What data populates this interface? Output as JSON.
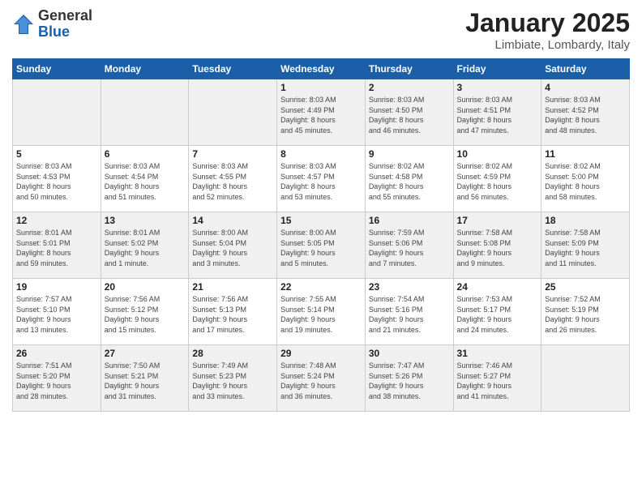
{
  "logo": {
    "general": "General",
    "blue": "Blue"
  },
  "title": "January 2025",
  "location": "Limbiate, Lombardy, Italy",
  "weekdays": [
    "Sunday",
    "Monday",
    "Tuesday",
    "Wednesday",
    "Thursday",
    "Friday",
    "Saturday"
  ],
  "weeks": [
    [
      {
        "day": "",
        "info": ""
      },
      {
        "day": "",
        "info": ""
      },
      {
        "day": "",
        "info": ""
      },
      {
        "day": "1",
        "info": "Sunrise: 8:03 AM\nSunset: 4:49 PM\nDaylight: 8 hours\nand 45 minutes."
      },
      {
        "day": "2",
        "info": "Sunrise: 8:03 AM\nSunset: 4:50 PM\nDaylight: 8 hours\nand 46 minutes."
      },
      {
        "day": "3",
        "info": "Sunrise: 8:03 AM\nSunset: 4:51 PM\nDaylight: 8 hours\nand 47 minutes."
      },
      {
        "day": "4",
        "info": "Sunrise: 8:03 AM\nSunset: 4:52 PM\nDaylight: 8 hours\nand 48 minutes."
      }
    ],
    [
      {
        "day": "5",
        "info": "Sunrise: 8:03 AM\nSunset: 4:53 PM\nDaylight: 8 hours\nand 50 minutes."
      },
      {
        "day": "6",
        "info": "Sunrise: 8:03 AM\nSunset: 4:54 PM\nDaylight: 8 hours\nand 51 minutes."
      },
      {
        "day": "7",
        "info": "Sunrise: 8:03 AM\nSunset: 4:55 PM\nDaylight: 8 hours\nand 52 minutes."
      },
      {
        "day": "8",
        "info": "Sunrise: 8:03 AM\nSunset: 4:57 PM\nDaylight: 8 hours\nand 53 minutes."
      },
      {
        "day": "9",
        "info": "Sunrise: 8:02 AM\nSunset: 4:58 PM\nDaylight: 8 hours\nand 55 minutes."
      },
      {
        "day": "10",
        "info": "Sunrise: 8:02 AM\nSunset: 4:59 PM\nDaylight: 8 hours\nand 56 minutes."
      },
      {
        "day": "11",
        "info": "Sunrise: 8:02 AM\nSunset: 5:00 PM\nDaylight: 8 hours\nand 58 minutes."
      }
    ],
    [
      {
        "day": "12",
        "info": "Sunrise: 8:01 AM\nSunset: 5:01 PM\nDaylight: 8 hours\nand 59 minutes."
      },
      {
        "day": "13",
        "info": "Sunrise: 8:01 AM\nSunset: 5:02 PM\nDaylight: 9 hours\nand 1 minute."
      },
      {
        "day": "14",
        "info": "Sunrise: 8:00 AM\nSunset: 5:04 PM\nDaylight: 9 hours\nand 3 minutes."
      },
      {
        "day": "15",
        "info": "Sunrise: 8:00 AM\nSunset: 5:05 PM\nDaylight: 9 hours\nand 5 minutes."
      },
      {
        "day": "16",
        "info": "Sunrise: 7:59 AM\nSunset: 5:06 PM\nDaylight: 9 hours\nand 7 minutes."
      },
      {
        "day": "17",
        "info": "Sunrise: 7:58 AM\nSunset: 5:08 PM\nDaylight: 9 hours\nand 9 minutes."
      },
      {
        "day": "18",
        "info": "Sunrise: 7:58 AM\nSunset: 5:09 PM\nDaylight: 9 hours\nand 11 minutes."
      }
    ],
    [
      {
        "day": "19",
        "info": "Sunrise: 7:57 AM\nSunset: 5:10 PM\nDaylight: 9 hours\nand 13 minutes."
      },
      {
        "day": "20",
        "info": "Sunrise: 7:56 AM\nSunset: 5:12 PM\nDaylight: 9 hours\nand 15 minutes."
      },
      {
        "day": "21",
        "info": "Sunrise: 7:56 AM\nSunset: 5:13 PM\nDaylight: 9 hours\nand 17 minutes."
      },
      {
        "day": "22",
        "info": "Sunrise: 7:55 AM\nSunset: 5:14 PM\nDaylight: 9 hours\nand 19 minutes."
      },
      {
        "day": "23",
        "info": "Sunrise: 7:54 AM\nSunset: 5:16 PM\nDaylight: 9 hours\nand 21 minutes."
      },
      {
        "day": "24",
        "info": "Sunrise: 7:53 AM\nSunset: 5:17 PM\nDaylight: 9 hours\nand 24 minutes."
      },
      {
        "day": "25",
        "info": "Sunrise: 7:52 AM\nSunset: 5:19 PM\nDaylight: 9 hours\nand 26 minutes."
      }
    ],
    [
      {
        "day": "26",
        "info": "Sunrise: 7:51 AM\nSunset: 5:20 PM\nDaylight: 9 hours\nand 28 minutes."
      },
      {
        "day": "27",
        "info": "Sunrise: 7:50 AM\nSunset: 5:21 PM\nDaylight: 9 hours\nand 31 minutes."
      },
      {
        "day": "28",
        "info": "Sunrise: 7:49 AM\nSunset: 5:23 PM\nDaylight: 9 hours\nand 33 minutes."
      },
      {
        "day": "29",
        "info": "Sunrise: 7:48 AM\nSunset: 5:24 PM\nDaylight: 9 hours\nand 36 minutes."
      },
      {
        "day": "30",
        "info": "Sunrise: 7:47 AM\nSunset: 5:26 PM\nDaylight: 9 hours\nand 38 minutes."
      },
      {
        "day": "31",
        "info": "Sunrise: 7:46 AM\nSunset: 5:27 PM\nDaylight: 9 hours\nand 41 minutes."
      },
      {
        "day": "",
        "info": ""
      }
    ]
  ]
}
